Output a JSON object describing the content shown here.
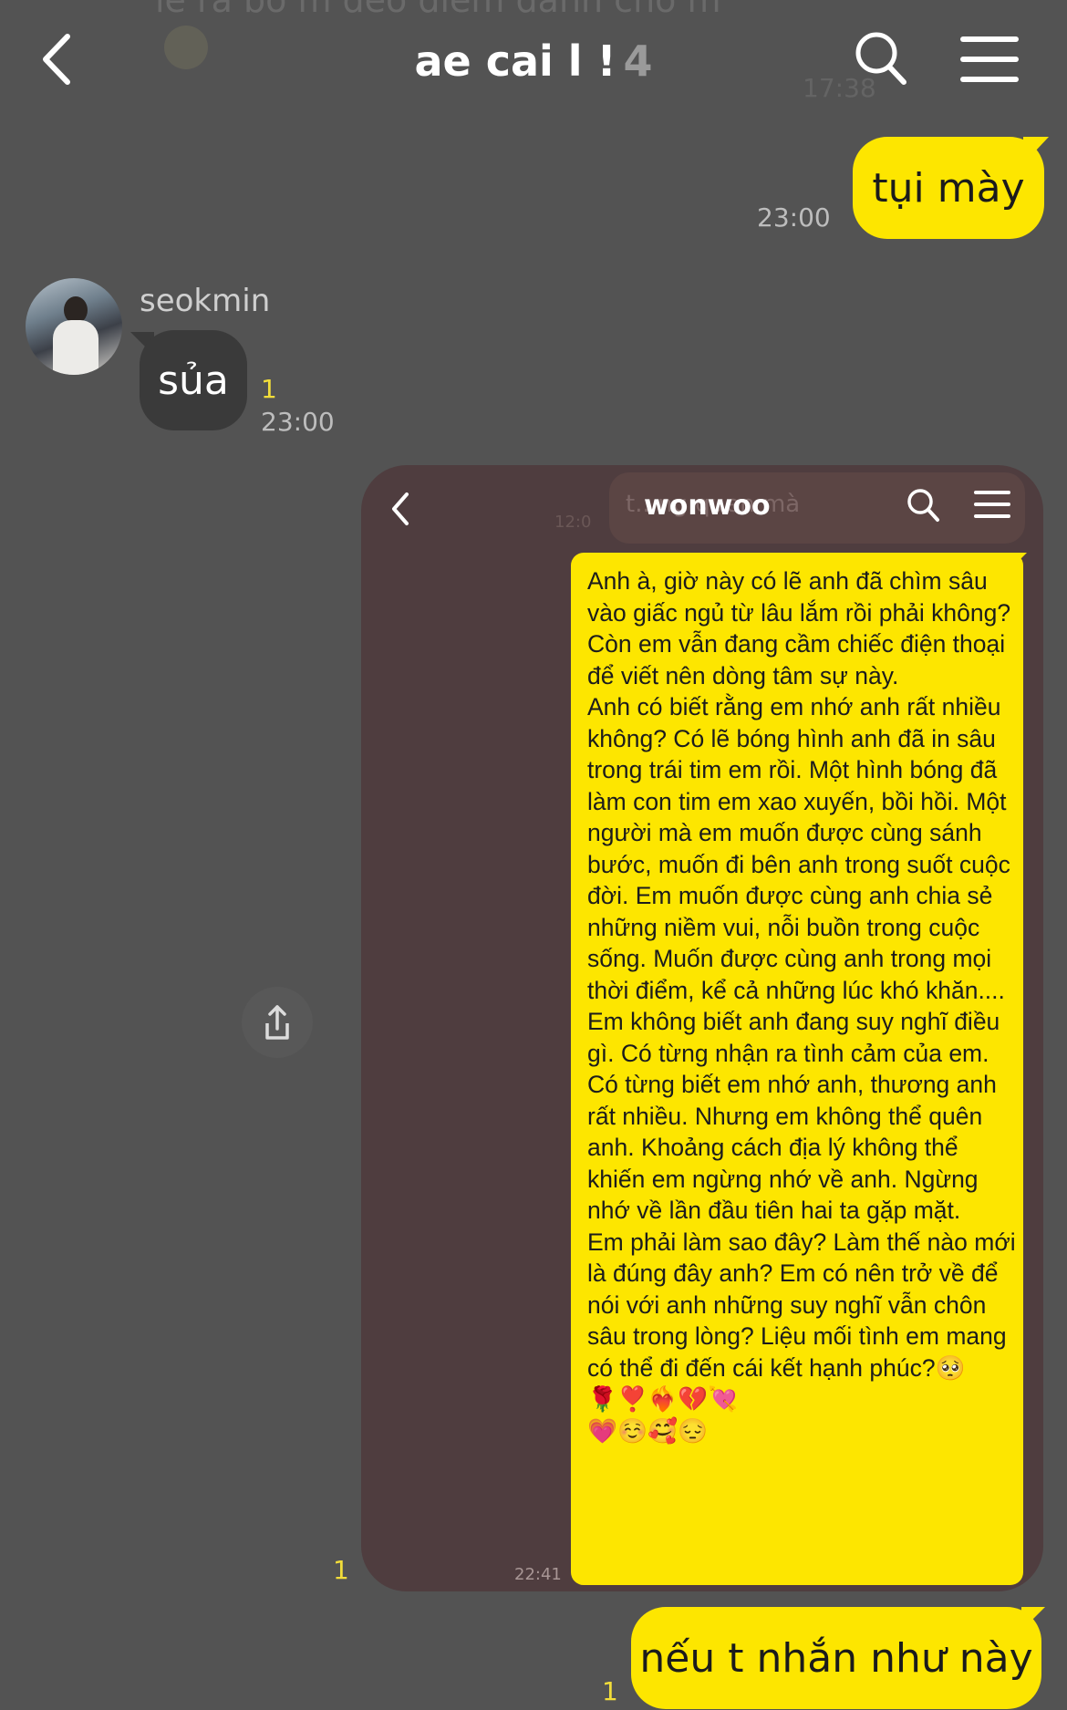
{
  "background_ghost": {
    "text": "lẽ ra bố m đéo điểm danh cho m",
    "time": "17:38"
  },
  "header": {
    "title": "ae cai l !",
    "member_count": "4",
    "back_icon": "chevron-left-icon",
    "search_icon": "search-icon",
    "menu_icon": "hamburger-menu-icon"
  },
  "messages": [
    {
      "sender": "me",
      "text": "tụi mày",
      "time": "23:00"
    },
    {
      "sender": "seokmin",
      "name": "seokmin",
      "text": "sủa",
      "unread": "1",
      "time": "23:00"
    },
    {
      "sender": "me",
      "type": "image",
      "unread": "1",
      "screenshot": {
        "title": "wonwoo",
        "ghost_text": "t...ng quen mà",
        "ghost_time": "12:0",
        "time": "22:41",
        "letter": "Anh à, giờ này có lẽ anh đã chìm sâu vào giấc ngủ từ lâu lắm rồi phải không? Còn em vẫn đang cầm chiếc điện thoại để viết nên dòng tâm sự này.\nAnh có biết rằng em nhớ anh rất nhiều không? Có lẽ bóng hình anh đã in sâu trong trái tim em rồi. Một hình bóng đã làm con tim em xao xuyến, bồi hồi. Một người mà em muốn được cùng sánh bước, muốn đi bên anh trong suốt cuộc đời. Em muốn được cùng anh chia sẻ những niềm vui, nỗi buồn trong cuộc sống. Muốn được cùng anh trong mọi thời điểm, kể cả những lúc khó khăn....\nEm không biết anh đang suy nghĩ điều gì. Có từng nhận ra tình cảm của em. Có từng biết em nhớ anh, thương anh rất nhiều. Nhưng em không thể quên anh. Khoảng cách địa lý không thể khiến em ngừng nhớ về anh. Ngừng nhớ về lần đầu tiên hai ta gặp mặt.\nEm phải làm sao đây? Làm thế nào mới là đúng đây anh? Em có nên trở về để nói với anh những suy nghĩ vẫn chôn sâu trong lòng? Liệu mối tình em mang có thể đi đến cái kết hạnh phúc?🥺🌹❣️❤️‍🔥💔💘\n💗☺️🥰😔"
      },
      "share_icon": "share-icon"
    },
    {
      "sender": "me",
      "text": "nếu t nhắn như này",
      "unread": "1"
    }
  ],
  "colors": {
    "background": "#535353",
    "my_bubble": "#fde600",
    "their_bubble": "#3a3a3a",
    "unread": "#f2dd3a"
  }
}
